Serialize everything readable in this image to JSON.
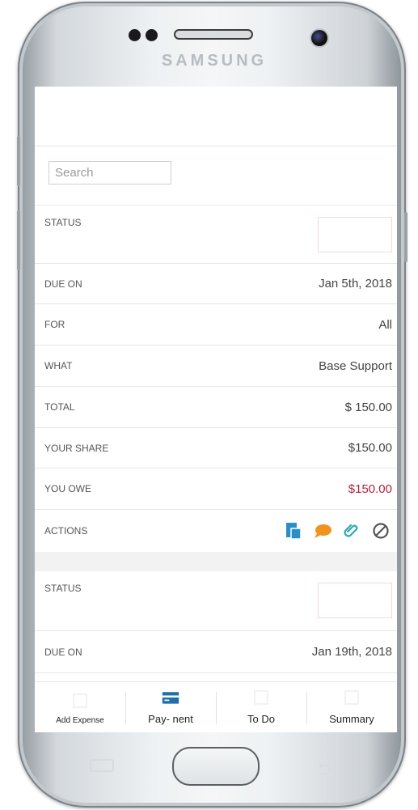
{
  "device": {
    "brand": "SAMSUNG"
  },
  "search": {
    "placeholder": "Search"
  },
  "expense_1": {
    "status_label": "STATUS",
    "due_label": "DUE ON",
    "due_value": "Jan 5th, 2018",
    "for_label": "FOR",
    "for_value": "All",
    "what_label": "WHAT",
    "what_value": "Base Support",
    "total_label": "TOTAL",
    "total_value": "$ 150.00",
    "share_label": "YOUR SHARE",
    "share_value": "$150.00",
    "owe_label": "YOU OWE",
    "owe_value": "$150.00",
    "actions_label": "ACTIONS",
    "action_icons": [
      "document-icon",
      "comment-icon",
      "attachment-icon",
      "cancel-icon"
    ]
  },
  "expense_2": {
    "status_label": "STATUS",
    "due_label": "DUE ON",
    "due_value": "Jan 19th, 2018"
  },
  "tabs": [
    {
      "label": "Add Expense",
      "icon": "add-expense-icon"
    },
    {
      "label": "Pay‐ nent",
      "icon": "card-icon"
    },
    {
      "label": "To Do",
      "icon": "todo-icon"
    },
    {
      "label": "Summary",
      "icon": "summary-icon"
    }
  ],
  "colors": {
    "owe": "#b0233a",
    "action_blue": "#2a8fc7",
    "action_orange": "#f0921e",
    "action_teal": "#2aaab6",
    "card_blue": "#1f6fb0"
  }
}
